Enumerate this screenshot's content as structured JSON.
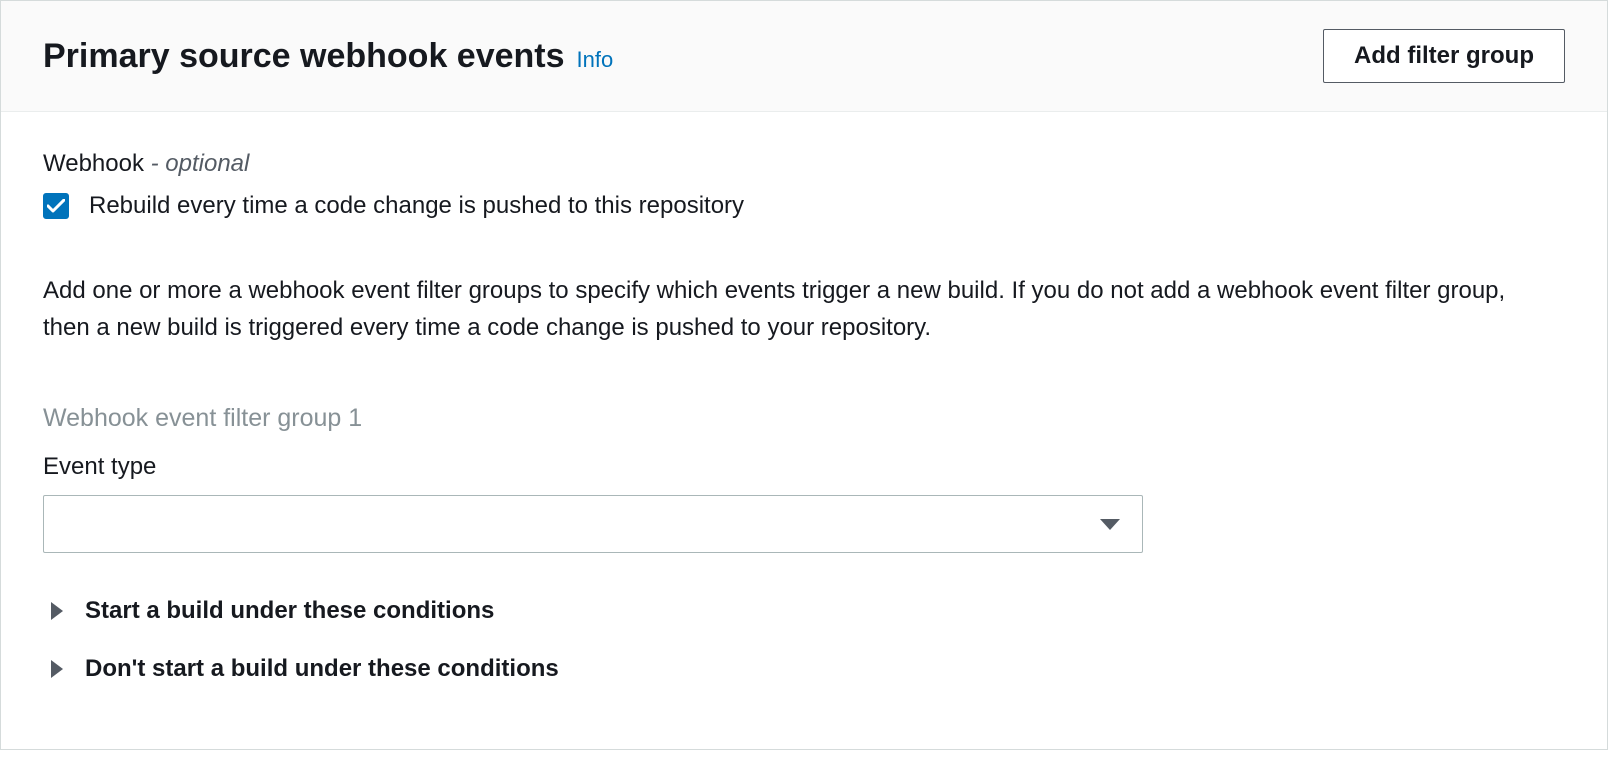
{
  "header": {
    "title": "Primary source webhook events",
    "info_label": "Info",
    "add_filter_group_label": "Add filter group"
  },
  "webhook": {
    "label_prefix": "Webhook ",
    "label_optional": "- optional",
    "checkbox_checked": true,
    "checkbox_label": "Rebuild every time a code change is pushed to this repository"
  },
  "description": "Add one or more a webhook event filter groups to specify which events trigger a new build. If you do not add a webhook event filter group, then a new build is triggered every time a code change is pushed to your repository.",
  "filter_group": {
    "heading": "Webhook event filter group 1",
    "event_type_label": "Event type",
    "event_type_value": ""
  },
  "expanders": {
    "start_conditions": "Start a build under these conditions",
    "dont_start_conditions": "Don't start a build under these conditions"
  }
}
